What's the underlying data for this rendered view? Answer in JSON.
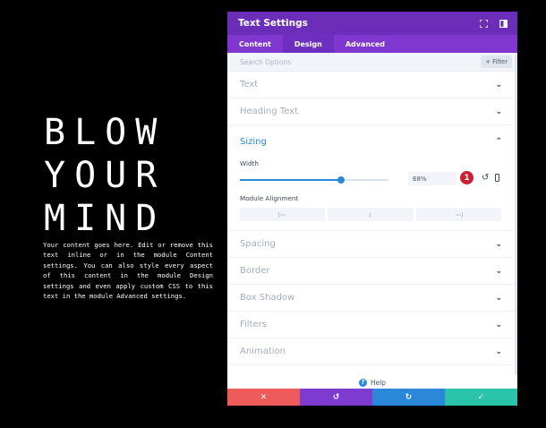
{
  "hero": {
    "title": "BLOW\nYOUR\nMIND",
    "body": "Your content goes here. Edit or remove this text inline or in the module Content settings. You can also style every aspect of this content in the module Design settings and even apply custom CSS to this text in the module Advanced settings."
  },
  "modal": {
    "title": "Text Settings",
    "header_icons": [
      "expand-icon",
      "sidebar-icon"
    ],
    "tabs": [
      {
        "label": "Content",
        "active": false
      },
      {
        "label": "Design",
        "active": true
      },
      {
        "label": "Advanced",
        "active": false
      }
    ],
    "search": {
      "placeholder": "Search Options",
      "filter_label": "+ Filter"
    },
    "sections_before": [
      {
        "label": "Text"
      },
      {
        "label": "Heading Text"
      }
    ],
    "sizing": {
      "label": "Sizing",
      "width_label": "Width",
      "width_value": "68%",
      "slider_fraction": 0.68,
      "badge": "1",
      "alignment_label": "Module Alignment",
      "alignment_options": [
        "left",
        "center",
        "right"
      ]
    },
    "sections_after": [
      {
        "label": "Spacing"
      },
      {
        "label": "Border"
      },
      {
        "label": "Box Shadow"
      },
      {
        "label": "Filters"
      },
      {
        "label": "Animation"
      }
    ],
    "help_label": "Help",
    "footer": {
      "cancel": {
        "icon": "close-icon",
        "color": "#ef5a5a"
      },
      "undo": {
        "icon": "undo-icon",
        "color": "#7e3bd0"
      },
      "redo": {
        "icon": "redo-icon",
        "color": "#2b87da"
      },
      "save": {
        "icon": "check-icon",
        "color": "#29c4a9"
      }
    }
  },
  "colors": {
    "header": "#6c2eb9",
    "tabs": "#8037d0",
    "accent": "#2b87da",
    "badge": "#cc1f2f"
  }
}
